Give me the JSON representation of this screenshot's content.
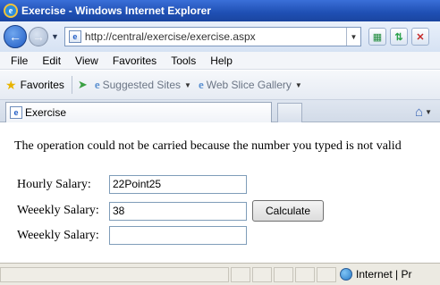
{
  "window": {
    "title": "Exercise - Windows Internet Explorer",
    "logo_letter": "e"
  },
  "address_bar": {
    "url": "http://central/exercise/exercise.aspx",
    "page_icon": "e"
  },
  "menu": {
    "items": [
      "File",
      "Edit",
      "View",
      "Favorites",
      "Tools",
      "Help"
    ]
  },
  "favorites_bar": {
    "favorites_label": "Favorites",
    "suggested_sites": "Suggested Sites",
    "web_slice_gallery": "Web Slice Gallery",
    "e_glyph": "e"
  },
  "tabs": {
    "active_label": "Exercise",
    "tab_icon": "e"
  },
  "page": {
    "message": "The operation could not be carried because the number you typed is not valid",
    "hourly_label": "Hourly Salary:",
    "hourly_value": "22Point25",
    "weekly_label_1": "Weeekly Salary:",
    "weekly_value_1": "38",
    "calculate_label": "Calculate",
    "weekly_label_2": "Weeekly Salary:",
    "weekly_value_2": ""
  },
  "status_bar": {
    "zone_label": "Internet | Pr"
  },
  "icons": {
    "back": "arrow-left-icon",
    "forward": "arrow-right-icon",
    "refresh": "refresh-icon",
    "stop": "close-icon",
    "home": "home-icon",
    "star": "star-icon",
    "globe": "globe-icon"
  }
}
